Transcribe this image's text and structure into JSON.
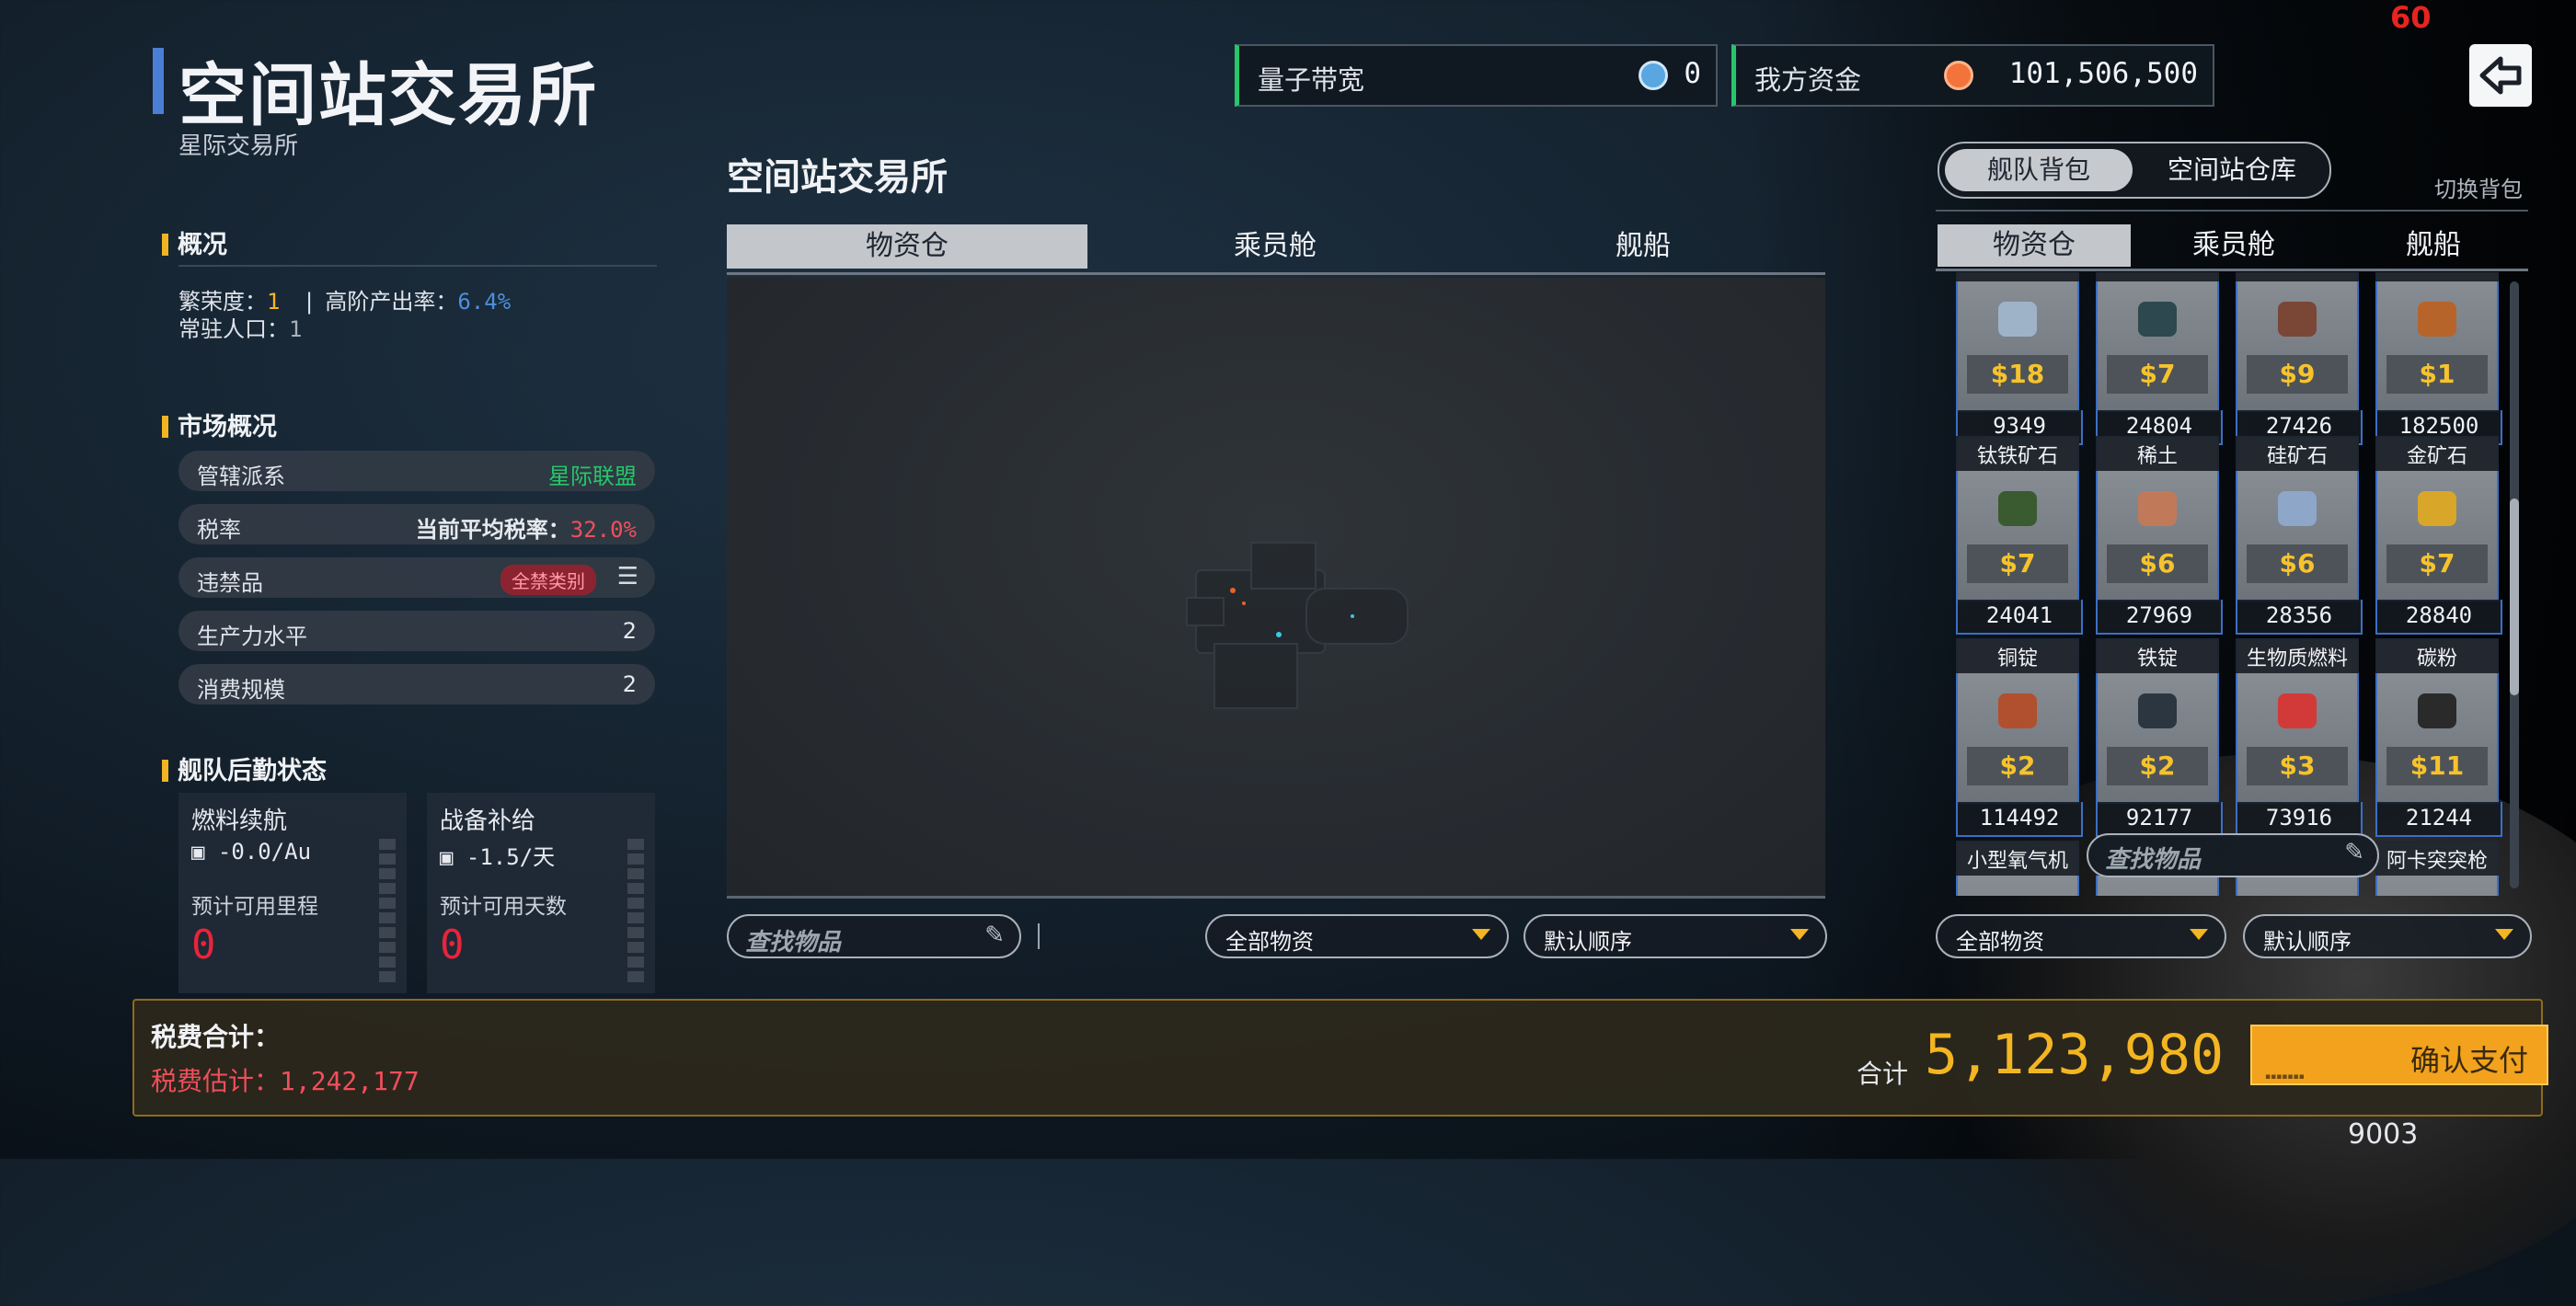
{
  "fps": "60",
  "footer_number": "9003",
  "header": {
    "title": "空间站交易所",
    "subtitle": "星际交易所"
  },
  "overview": {
    "heading": "概况",
    "prosperity_label": "繁荣度：",
    "prosperity_value": "1",
    "sep": "|",
    "high_tier_label": "高阶产出率：",
    "high_tier_value": "6.4%",
    "population_label": "常驻人口：",
    "population_value": "1"
  },
  "market": {
    "heading": "市场概况",
    "rows": [
      {
        "label": "管辖派系",
        "value": "星际联盟"
      },
      {
        "label": "税率",
        "value_prefix": "当前平均税率：",
        "value": "32.0%"
      },
      {
        "label": "违禁品",
        "badge": "全禁类别"
      },
      {
        "label": "生产力水平",
        "value": "2"
      },
      {
        "label": "消费规模",
        "value": "2"
      }
    ]
  },
  "logistics": {
    "heading": "舰队后勤状态",
    "boxes": [
      {
        "title": "燃料续航",
        "rate": "-0.0/Au",
        "sub": "预计可用里程",
        "value": "0"
      },
      {
        "title": "战备补给",
        "rate": "-1.5/天",
        "sub": "预计可用天数",
        "value": "0"
      }
    ]
  },
  "stats": {
    "quantum_label": "量子带宽",
    "quantum_value": "0",
    "funds_label": "我方资金",
    "funds_value": "101,506,500"
  },
  "middle": {
    "title": "空间站交易所",
    "tabs": [
      "物资仓",
      "乘员舱",
      "舰船"
    ],
    "search_placeholder": "查找物品",
    "filter": "全部物资",
    "sort": "默认顺序"
  },
  "right": {
    "toggle_on": "舰队背包",
    "toggle_off": "空间站仓库",
    "switch_label": "切换背包",
    "tabs": [
      "物资仓",
      "乘员舱",
      "舰船"
    ],
    "items": [
      {
        "name": "",
        "price": "$18",
        "qty": "9349",
        "color": "#9fb3c8"
      },
      {
        "name": "",
        "price": "$7",
        "qty": "24804",
        "color": "#2e4850"
      },
      {
        "name": "",
        "price": "$9",
        "qty": "27426",
        "color": "#7a4636"
      },
      {
        "name": "",
        "price": "$1",
        "qty": "182500",
        "color": "#b6642a"
      },
      {
        "name": "钛铁矿石",
        "price": "$7",
        "qty": "24041",
        "color": "#3a5a30"
      },
      {
        "name": "稀土",
        "price": "$6",
        "qty": "27969",
        "color": "#c07a5a"
      },
      {
        "name": "硅矿石",
        "price": "$6",
        "qty": "28356",
        "color": "#8ea6c8"
      },
      {
        "name": "金矿石",
        "price": "$7",
        "qty": "28840",
        "color": "#d8a628"
      },
      {
        "name": "铜锭",
        "price": "$2",
        "qty": "114492",
        "color": "#b0502e"
      },
      {
        "name": "铁锭",
        "price": "$2",
        "qty": "92177",
        "color": "#2c3640"
      },
      {
        "name": "生物质燃料",
        "price": "$3",
        "qty": "73916",
        "color": "#d23a3a"
      },
      {
        "name": "碳粉",
        "price": "$11",
        "qty": "21244",
        "color": "#2a2a2a"
      },
      {
        "name": "小型氧气机",
        "price": "",
        "qty": "",
        "color": "#555"
      },
      {
        "name": "",
        "price": "",
        "qty": "",
        "color": "#555"
      },
      {
        "name": "",
        "price": "",
        "qty": "",
        "color": "#555"
      },
      {
        "name": "阿卡突突枪",
        "price": "",
        "qty": "",
        "color": "#555"
      }
    ],
    "search_placeholder": "查找物品",
    "filter": "全部物资",
    "sort": "默认顺序"
  },
  "footer": {
    "tax_heading": "税费合计：",
    "tax_estimate": "税费估计：1,242,177",
    "total_label": "合计",
    "total_value": "5,123,980",
    "confirm": "确认支付"
  }
}
